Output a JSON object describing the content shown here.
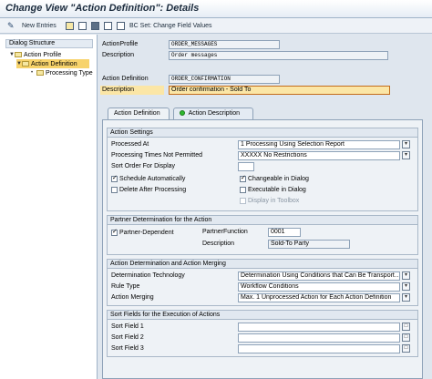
{
  "window": {
    "title": "Change View \"Action Definition\": Details"
  },
  "toolbar": {
    "new_entries": "New Entries",
    "bc_set": "BC Set: Change Field Values"
  },
  "dialog_structure": {
    "header": "Dialog Structure",
    "items": [
      {
        "label": "Action Profile"
      },
      {
        "label": "Action Definition"
      },
      {
        "label": "Processing Type"
      }
    ]
  },
  "header_fields": {
    "action_profile_label": "ActionProfile",
    "action_profile_value": "ORDER_MESSAGES",
    "description1_label": "Description",
    "description1_value": "Order messages",
    "action_definition_label": "Action Definition",
    "action_definition_value": "ORDER_CONFIRMATION",
    "description2_label": "Description",
    "description2_value": "Order confirmation - Sold To"
  },
  "tabs": {
    "action_definition": "Action Definition",
    "action_description": "Action Description"
  },
  "action_settings": {
    "title": "Action Settings",
    "processed_at_label": "Processed At",
    "processed_at_value": "1 Processing Using Selection Report",
    "processing_times_label": "Processing Times Not Permitted",
    "processing_times_value": "XXXXX No Restrictions",
    "sort_order_label": "Sort Order For Display",
    "sort_order_value": "",
    "schedule_automatically": "Schedule Automatically",
    "changeable_in_dialog": "Changeable in Dialog",
    "delete_after_processing": "Delete After Processing",
    "executable_in_dialog": "Executable in Dialog",
    "display_in_toolbox": "Display in Toolbox"
  },
  "partner": {
    "title": "Partner Determination for the Action",
    "partner_dependent": "Partner-Dependent",
    "partner_function_label": "PartnerFunction",
    "partner_function_value": "0001",
    "description_label": "Description",
    "description_value": "Sold-To Party"
  },
  "determination": {
    "title": "Action Determination and Action Merging",
    "technology_label": "Determination Technology",
    "technology_value": "Determination Using Conditions that Can Be Transport…",
    "rule_type_label": "Rule Type",
    "rule_type_value": "Workflow Conditions",
    "merging_label": "Action Merging",
    "merging_value": "Max. 1 Unprocessed Action for Each Action Definition"
  },
  "sort_fields": {
    "title": "Sort Fields for the Execution of Actions",
    "field1_label": "Sort Field 1",
    "field2_label": "Sort Field 2",
    "field3_label": "Sort Field 3"
  }
}
